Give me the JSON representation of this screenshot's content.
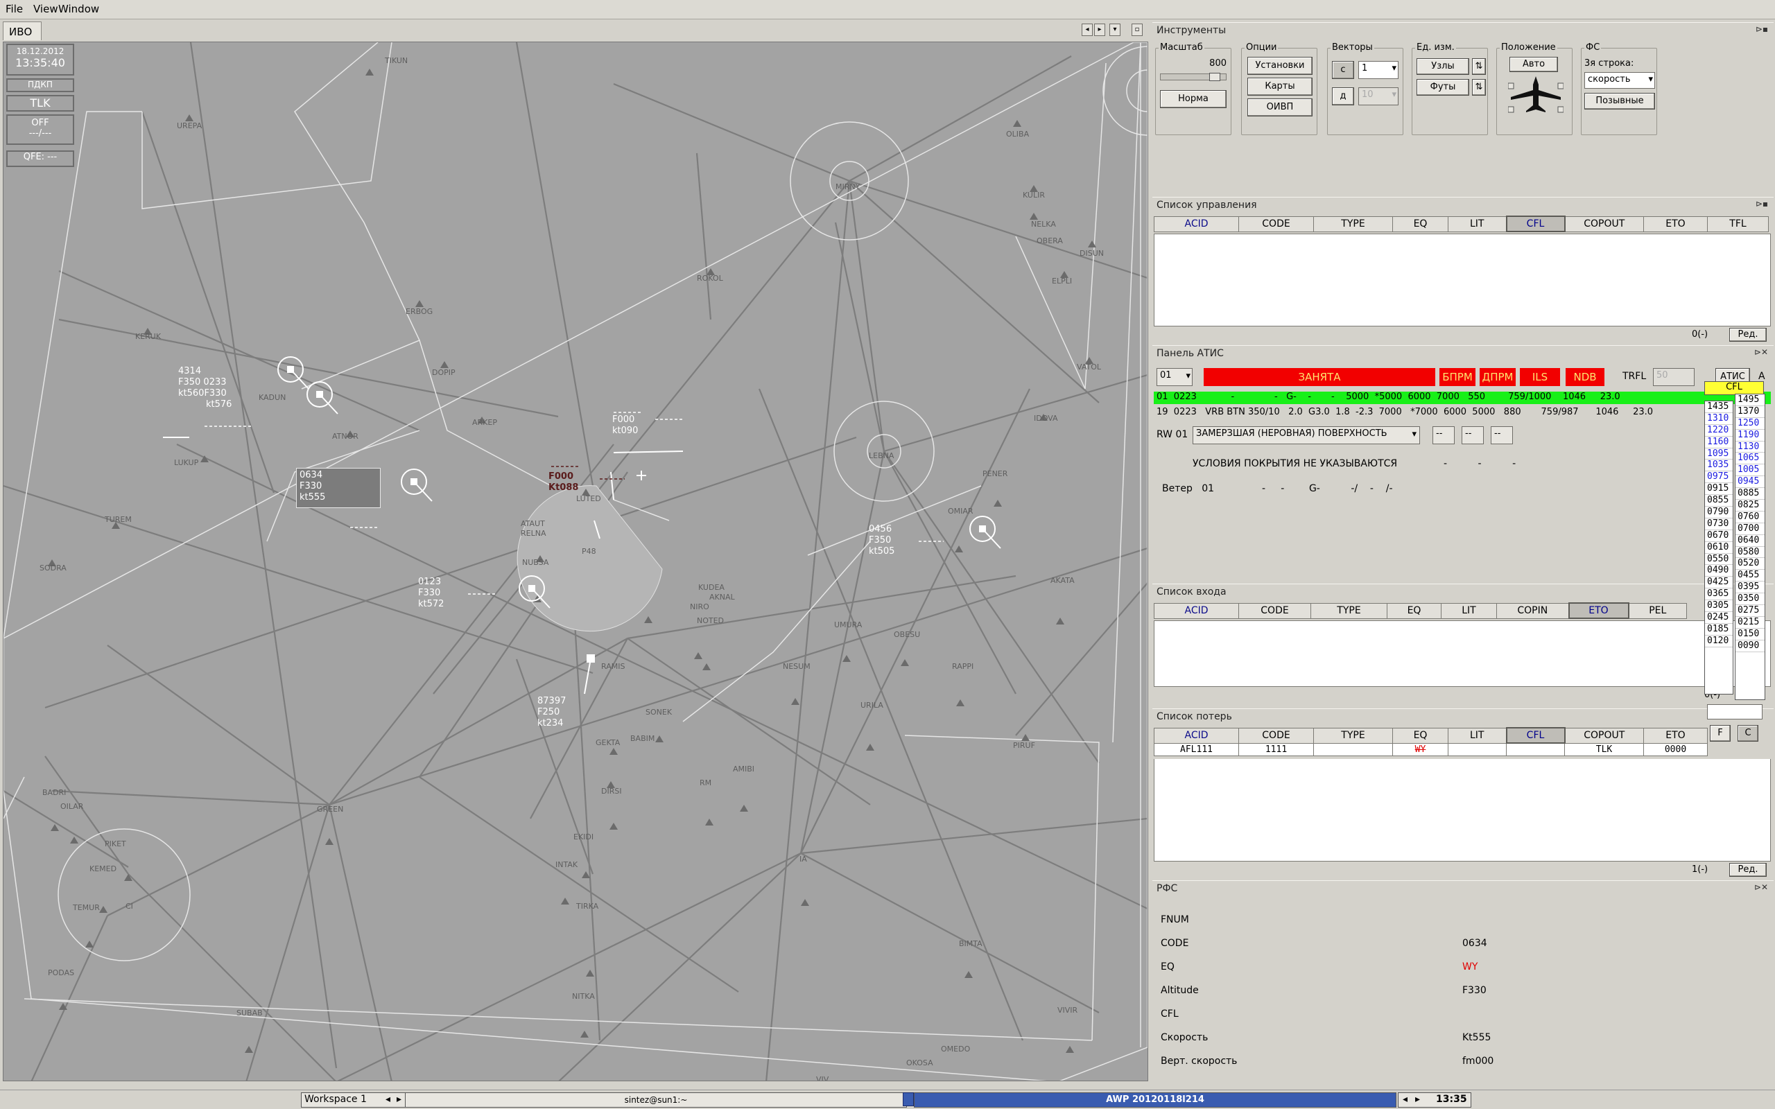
{
  "menu": {
    "file": "File",
    "view": "View",
    "window": "Window"
  },
  "tab": {
    "label": "ИВО"
  },
  "radar_info": {
    "date": "18.12.2012",
    "time": "13:35:40",
    "pdkp": "ПДКП",
    "tlk": "TLK",
    "off": "OFF",
    "off_sub": "---/---",
    "qfe": "QFE: ---"
  },
  "waypoints": [
    "UREPA",
    "TIKUN",
    "OLIBA",
    "KULIR",
    "NELKA",
    "OBERA",
    "DISUN",
    "ELPLI",
    "VATOL",
    "KERUK",
    "ERBOG",
    "ROKOL",
    "MIRNY",
    "DOPIP",
    "ARKEP",
    "ATNOR",
    "KADUN",
    "LUKUP",
    "TUREM",
    "SODRA",
    "LUTED",
    "ATAUT",
    "RELNA",
    "NUBSA",
    "P48",
    "KUDEA",
    "AKNAL",
    "NIRO",
    "NOTED",
    "LEBNA",
    "IDOVA",
    "PENER",
    "OMIAR",
    "AKATA",
    "UMURA",
    "OBESU",
    "NESUM",
    "RAPPI",
    "PIRUF",
    "URILA",
    "SONEK",
    "BABIM",
    "GEKTA",
    "RAMIS",
    "AMIBI",
    "DIRSI",
    "RM",
    "GREEN",
    "BADRI",
    "OILAR",
    "PIKET",
    "KEMED",
    "CI",
    "TEMUR",
    "PODAS",
    "EKIDI",
    "INTAK",
    "TIRKA",
    "IA",
    "BIMTA",
    "NITKA",
    "SUBAB",
    "OMEDO",
    "OKOSA",
    "VIVIR",
    "VIV"
  ],
  "tracks": [
    {
      "line1": "4314",
      "line2": "F350  0233",
      "line3": "kt560F330",
      "line4": "kt576"
    },
    {
      "line1": "0634",
      "line2": "F330",
      "line3": "kt555"
    },
    {
      "line1": "F000",
      "line2": "Kt088"
    },
    {
      "line1": "F000",
      "line2": "kt090"
    },
    {
      "line1": "0123",
      "line2": "F330",
      "line3": "kt572"
    },
    {
      "line1": "0456",
      "line2": "F350",
      "line3": "kt505"
    },
    {
      "line1": "87397",
      "line2": "F250",
      "line3": "kt234"
    }
  ],
  "instruments": {
    "title": "Инструменты",
    "scale_label": "Масштаб",
    "scale_value": "800",
    "norm_btn": "Норма",
    "options_label": "Опции",
    "opt_settings": "Установки",
    "opt_maps": "Карты",
    "opt_oivp": "ОИВП",
    "vectors_label": "Векторы",
    "vec_c": "с",
    "vec_c_val": "1",
    "vec_d": "д",
    "vec_d_val": "10",
    "units_label": "Ед. изм.",
    "unit_knots": "Узлы",
    "unit_feet": "Футы",
    "pos_label": "Положение",
    "pos_auto": "Авто",
    "fs_label": "ФС",
    "fs_row3": "3я строка:",
    "fs_select": "скорость",
    "fs_callsigns": "Позывные"
  },
  "control_list": {
    "title": "Список управления",
    "columns": [
      "ACID",
      "CODE",
      "TYPE",
      "EQ",
      "LIT",
      "CFL",
      "COPOUT",
      "ETO",
      "TFL"
    ],
    "footer_count": "0(-)",
    "footer_edit": "Ред."
  },
  "atis": {
    "title": "Панель АТИС",
    "rwy_sel": "01",
    "busy": "ЗАНЯТА",
    "bprm": "БПРМ",
    "dprm": "ДПРМ",
    "ils": "ILS",
    "ndb": "NDB",
    "trfl": "TRFL",
    "trfl_val": "50",
    "atis_btn": "АТИС",
    "a": "А",
    "row1": "01  0223            -              -   G-    -       -    5000  *5000  6000  7000   550        759/1000    1046     23.0",
    "row2": "19  0223   VRB BTN 350/10   2.0  G3.0  1.8  -2.3  7000   *7000  6000  5000   880       759/987      1046     23.0",
    "rw": "RW  01",
    "rw_cond": "ЗАМЕРЗШАЯ (НЕРОВНАЯ) ПОВЕРХНОСТЬ",
    "dash": "--",
    "cover": "УСЛОВИЯ ПОКРЫТИЯ НЕ УКАЗЫВАЮТСЯ",
    "cover_dashes": "-          -          -",
    "wind": "Ветер   01",
    "wind_vals": "-     -        G-          -/    -    /-"
  },
  "cfl_popup": {
    "header": "CFL",
    "left": [
      "1435",
      "1310",
      "1220",
      "1160",
      "1095",
      "1035",
      "0975",
      "0915",
      "0855",
      "0790",
      "0730",
      "0670",
      "0610",
      "0550",
      "0490",
      "0425",
      "0365",
      "0305",
      "0245",
      "0185",
      "0120"
    ],
    "right": [
      "1495",
      "1370",
      "1250",
      "1190",
      "1130",
      "1065",
      "1005",
      "0945",
      "0885",
      "0825",
      "0760",
      "0700",
      "0640",
      "0580",
      "0520",
      "0455",
      "0395",
      "0350",
      "0275",
      "0215",
      "0150",
      "0090"
    ],
    "f_btn": "F",
    "c_btn": "C"
  },
  "entry_list": {
    "title": "Список входа",
    "columns": [
      "ACID",
      "CODE",
      "TYPE",
      "EQ",
      "LIT",
      "COPIN",
      "ETO",
      "PEL"
    ],
    "footer_count": "0(-)"
  },
  "loss_list": {
    "title": "Список потерь",
    "columns": [
      "ACID",
      "CODE",
      "TYPE",
      "EQ",
      "LIT",
      "CFL",
      "COPOUT",
      "ETO"
    ],
    "rows": [
      [
        "AFL111",
        "1111",
        "",
        "WY",
        "",
        "",
        "TLK",
        "0000"
      ]
    ],
    "footer_count": "1(-)",
    "footer_edit": "Ред."
  },
  "rfs": {
    "title": "РФС",
    "fields": [
      {
        "label": "FNUM",
        "value": ""
      },
      {
        "label": "CODE",
        "value": "0634"
      },
      {
        "label": "EQ",
        "value": "WY"
      },
      {
        "label": "Altitude",
        "value": "F330"
      },
      {
        "label": "CFL",
        "value": ""
      },
      {
        "label": "Скорость",
        "value": "Kt555"
      },
      {
        "label": "Верт. скорость",
        "value": "fm000"
      }
    ]
  },
  "taskbar": {
    "workspace": "Workspace 1",
    "terminal": "sintez@sun1:~",
    "app": "AWP 20120118l214",
    "clock": "13:35"
  },
  "colors": {
    "busy_red": "#f20000",
    "atis_green": "#18f018",
    "radar_bg": "#a3a3a3",
    "eq_red": "#e00000"
  }
}
